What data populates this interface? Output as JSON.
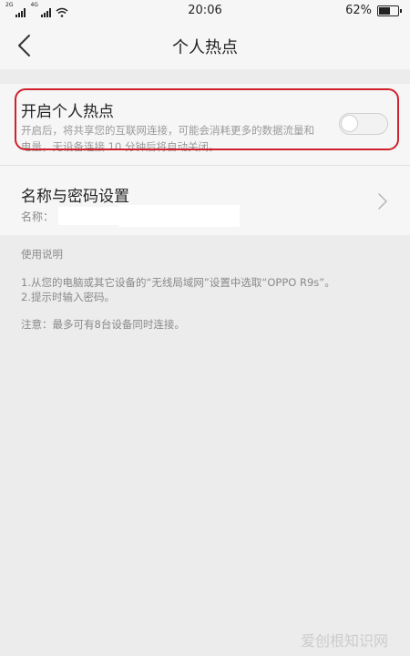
{
  "status_bar": {
    "network_top": "2G",
    "network_bottom": "4G",
    "time": "20:06",
    "battery_text": "62%",
    "battery_level": 0.62
  },
  "header": {
    "title": "个人热点"
  },
  "hotspot": {
    "title": "开启个人热点",
    "description": "开启后，将共享您的互联网连接，可能会消耗更多的数据流量和电量，无设备连接 10 分钟后将自动关闭。",
    "enabled": false
  },
  "name_password": {
    "title": "名称与密码设置",
    "name_label": "名称："
  },
  "instructions": {
    "heading": "使用说明",
    "step1": "1.从您的电脑或其它设备的“无线局域网”设置中选取“OPPO R9s”。",
    "step2": "2.提示时输入密码。",
    "note": "注意：最多可有8台设备同时连接。"
  },
  "watermark": "爱创根知识网",
  "colors": {
    "highlight": "#d0202a",
    "background": "#ececec",
    "card": "#f6f6f6"
  }
}
